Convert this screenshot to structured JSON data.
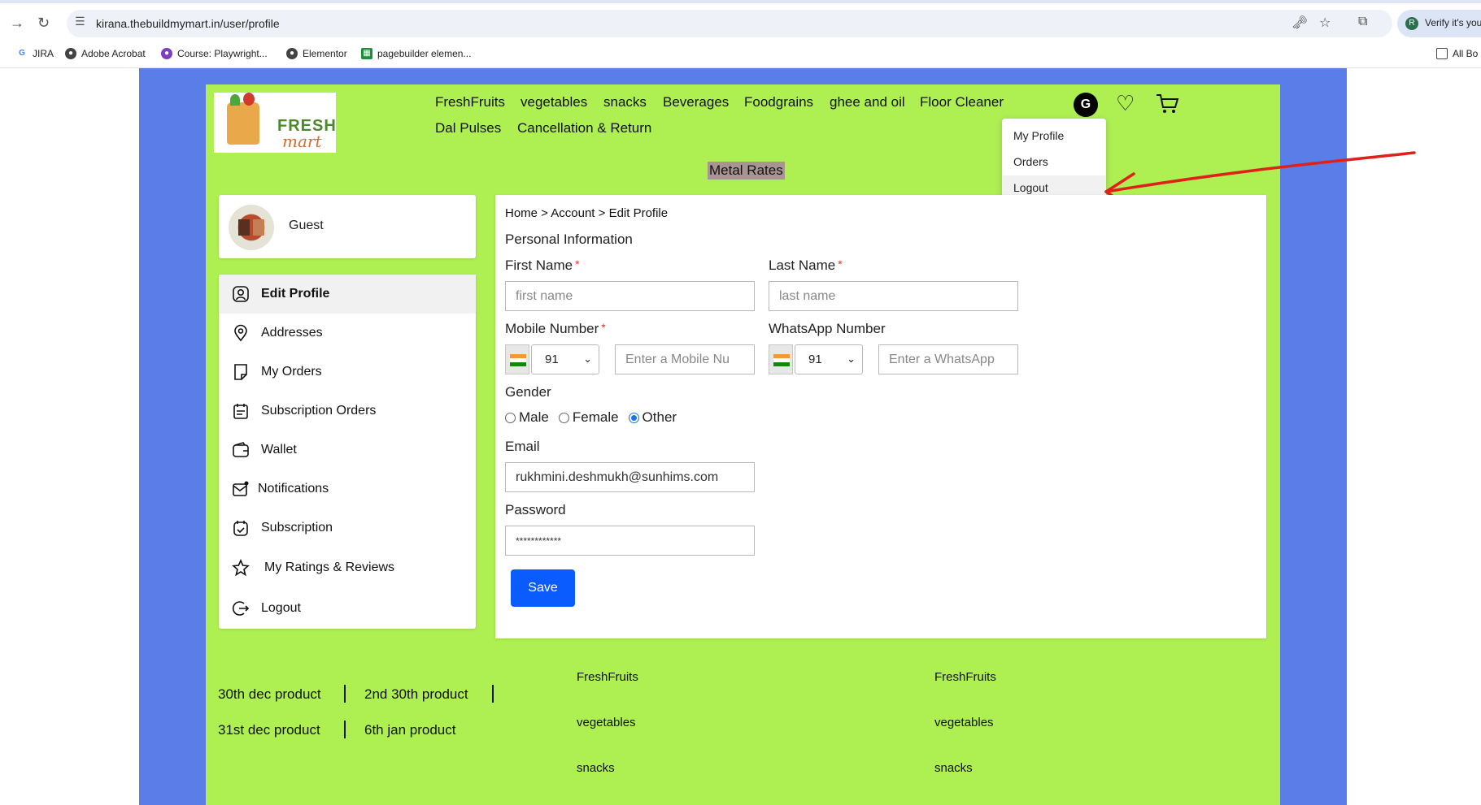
{
  "browser": {
    "url": "kirana.thebuildmymart.in/user/profile",
    "profile_chip": "Verify it's you",
    "bookmarks": [
      "JIRA",
      "Adobe Acrobat",
      "Course: Playwright...",
      "Elementor",
      "pagebuilder elemen..."
    ],
    "all_bookmarks": "All Bo"
  },
  "logo": {
    "word1": "FRESH",
    "word2": "mart"
  },
  "nav": {
    "items": [
      "FreshFruits",
      "vegetables",
      "snacks",
      "Beverages",
      "Foodgrains",
      "ghee and oil",
      "Floor Cleaner",
      "Dal Pulses",
      "Cancellation & Return"
    ],
    "avatar_letter": "G",
    "metal_rates": "Metal Rates"
  },
  "account_dropdown": {
    "items": [
      "My Profile",
      "Orders",
      "Logout"
    ]
  },
  "guest": {
    "name": "Guest"
  },
  "sidebar": {
    "items": [
      {
        "label": "Edit Profile",
        "icon": "user-circle-icon",
        "active": true
      },
      {
        "label": "Addresses",
        "icon": "location-pin-icon"
      },
      {
        "label": "My Orders",
        "icon": "receipt-icon"
      },
      {
        "label": "Subscription Orders",
        "icon": "calendar-list-icon"
      },
      {
        "label": "Wallet",
        "icon": "wallet-icon"
      },
      {
        "label": "Notifications",
        "icon": "mail-notification-icon"
      },
      {
        "label": "Subscription",
        "icon": "calendar-refresh-icon"
      },
      {
        "label": "My Ratings & Reviews",
        "icon": "star-rating-icon"
      },
      {
        "label": "Logout",
        "icon": "logout-icon"
      }
    ]
  },
  "form": {
    "breadcrumb": "Home > Account > Edit Profile",
    "section_title": "Personal Information",
    "first_name_label": "First Name",
    "first_name_placeholder": "first name",
    "last_name_label": "Last Name",
    "last_name_placeholder": "last name",
    "mobile_label": "Mobile Number",
    "mobile_code": "91",
    "mobile_placeholder": "Enter a Mobile Nu",
    "whatsapp_label": "WhatsApp Number",
    "whatsapp_code": "91",
    "whatsapp_placeholder": "Enter a WhatsApp",
    "gender_label": "Gender",
    "gender_options": [
      "Male",
      "Female",
      "Other"
    ],
    "gender_selected": "Other",
    "email_label": "Email",
    "email_value": "rukhmini.deshmukh@sunhims.com",
    "password_label": "Password",
    "password_value": "************",
    "required_mark": "*",
    "save_label": "Save"
  },
  "footer": {
    "products_row1": [
      "30th dec product",
      "2nd 30th product"
    ],
    "products_row2": [
      "31st dec product",
      "6th jan product"
    ],
    "col1": [
      "FreshFruits",
      "vegetables",
      "snacks"
    ],
    "col2": [
      "FreshFruits",
      "vegetables",
      "snacks"
    ]
  },
  "colors": {
    "site_bg": "#aeef52",
    "page_bg": "#5b7de8",
    "save_button": "#0b5cff",
    "annotation_arrow": "#e0201a"
  }
}
